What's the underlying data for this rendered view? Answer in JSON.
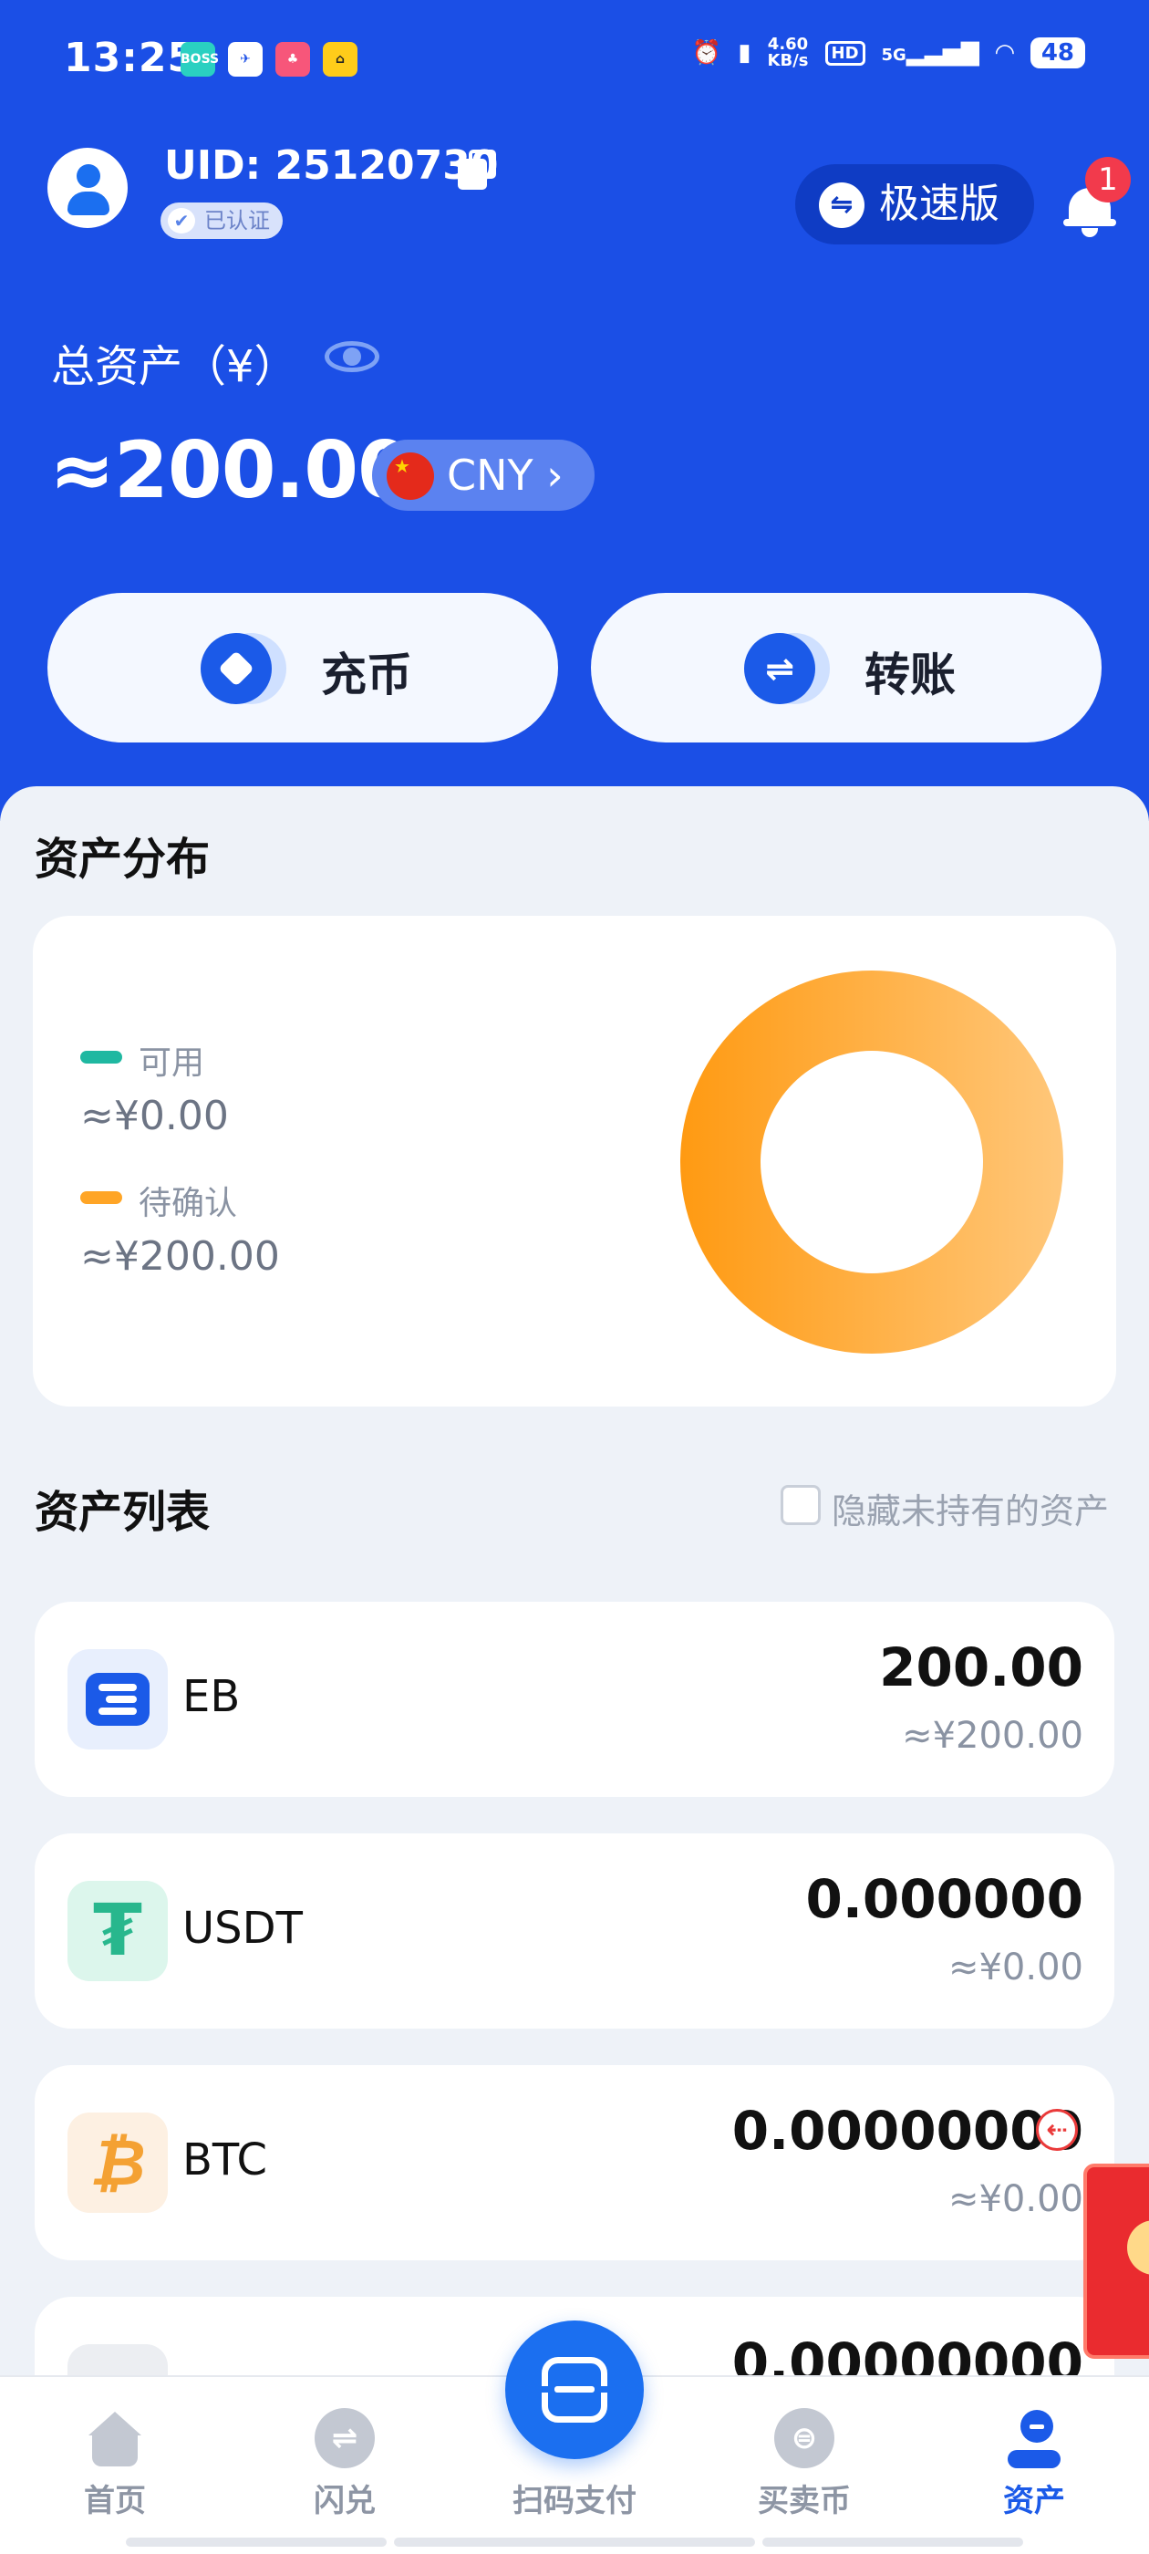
{
  "status_bar": {
    "time": "13:25",
    "apps": [
      "BOSS直聘",
      "bird-app",
      "game-app",
      "taxi-app"
    ],
    "speed_value": "4.60",
    "speed_unit": "KB/s",
    "hd": "HD",
    "network": "5G",
    "battery": "48"
  },
  "header": {
    "uid": "UID: 25120730",
    "verified": "已认证",
    "speed_mode": "极速版",
    "notification_count": "1"
  },
  "assets": {
    "total_label": "总资产（¥）",
    "total_value": "≈200.00",
    "currency": "CNY"
  },
  "actions": {
    "deposit": "充币",
    "transfer": "转账"
  },
  "distribution": {
    "title": "资产分布",
    "available_label": "可用",
    "available_value": "≈¥0.00",
    "pending_label": "待确认",
    "pending_value": "≈¥200.00",
    "available_color": "#1fb8a1",
    "pending_color": "#ffa526"
  },
  "chart_data": {
    "type": "pie",
    "categories": [
      "可用",
      "待确认"
    ],
    "values": [
      0.0,
      200.0
    ]
  },
  "asset_list": {
    "title": "资产列表",
    "hide_zero_label": "隐藏未持有的资产",
    "hide_zero_checked": false,
    "coins": [
      {
        "symbol": "EB",
        "amount": "200.00",
        "cny": "≈¥200.00"
      },
      {
        "symbol": "USDT",
        "amount": "0.000000",
        "cny": "≈¥0.00"
      },
      {
        "symbol": "BTC",
        "amount": "0.00000000",
        "cny": "≈¥0.00"
      },
      {
        "symbol": "",
        "amount": "0.00000000",
        "cny": ""
      }
    ]
  },
  "tabbar": {
    "home": "首页",
    "flash_swap": "闪兑",
    "scan_pay": "扫码支付",
    "trade": "买卖币",
    "assets": "资产"
  }
}
